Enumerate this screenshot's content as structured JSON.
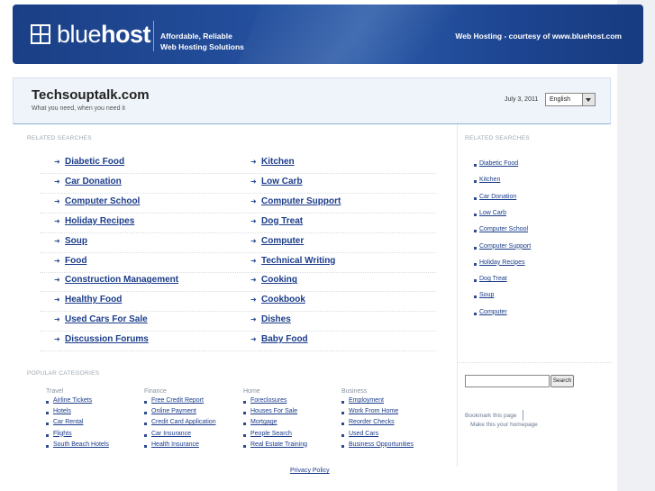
{
  "banner": {
    "logo_light": "blue",
    "logo_bold": "host",
    "tagline_line1": "Affordable, Reliable",
    "tagline_line2": "Web Hosting Solutions",
    "courtesy": "Web Hosting - courtesy of www.bluehost.com"
  },
  "header": {
    "title": "Techsouptalk.com",
    "subtitle": "What you need, when you need it",
    "date": "July 3, 2011",
    "language": "English"
  },
  "related": {
    "heading": "RELATED SEARCHES",
    "left": [
      "Diabetic Food",
      "Car Donation",
      "Computer School",
      "Holiday Recipes",
      "Soup",
      "Food",
      "Construction Management",
      "Healthy Food",
      "Used Cars For Sale",
      "Discussion Forums"
    ],
    "right": [
      "Kitchen",
      "Low Carb",
      "Computer Support",
      "Dog Treat",
      "Computer",
      "Technical Writing",
      "Cooking",
      "Cookbook",
      "Dishes",
      "Baby Food"
    ]
  },
  "popular": {
    "heading": "POPULAR CATEGORIES",
    "columns": [
      {
        "title": "Travel",
        "items": [
          "Airline Tickets",
          "Hotels",
          "Car Rental",
          "Flights",
          "South Beach Hotels"
        ]
      },
      {
        "title": "Finance",
        "items": [
          "Free Credit Report",
          "Online Payment",
          "Credit Card Application",
          "Car Insurance",
          "Health Insurance"
        ]
      },
      {
        "title": "Home",
        "items": [
          "Foreclosures",
          "Houses For Sale",
          "Mortgage",
          "People Search",
          "Real Estate Training"
        ]
      },
      {
        "title": "Business",
        "items": [
          "Employment",
          "Work From Home",
          "Reorder Checks",
          "Used Cars",
          "Business Opportunities"
        ]
      }
    ]
  },
  "sidebar": {
    "heading": "RELATED SEARCHES",
    "items": [
      "Diabetic Food",
      "Kitchen",
      "Car Donation",
      "Low Carb",
      "Computer School",
      "Computer Support",
      "Holiday Recipes",
      "Dog Treat",
      "Soup",
      "Computer"
    ],
    "search_button": "Search",
    "bookmark": "Bookmark this page",
    "homepage": "Make this your homepage"
  },
  "footer": {
    "privacy": "Privacy Policy"
  },
  "icons": {
    "logo": "bluehost-grid-icon",
    "link_arrow": "arrow-right-icon",
    "dropdown": "chevron-down-icon"
  },
  "colors": {
    "banner": "#234d9a",
    "link": "#1b3c8a",
    "header_bg": "#eef4fa"
  }
}
